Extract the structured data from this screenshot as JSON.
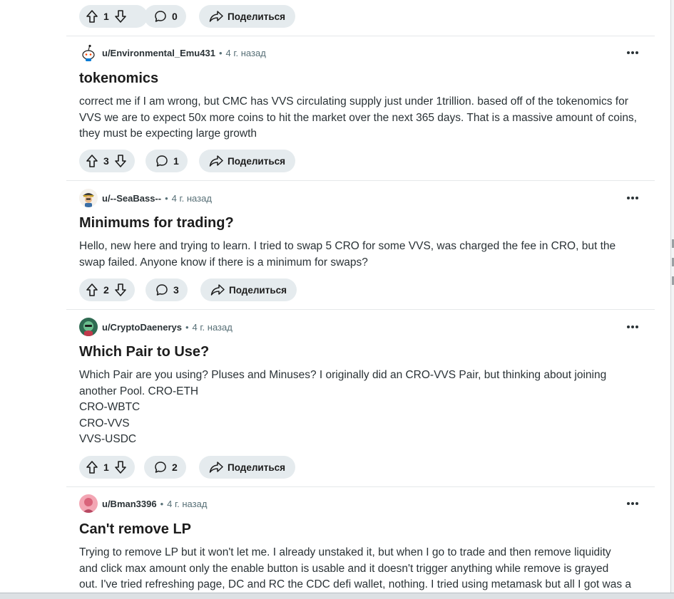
{
  "top_actions": {
    "votes": "1",
    "comments": "0",
    "share_label": "Поделиться"
  },
  "posts": [
    {
      "username": "u/Environmental_Emu431",
      "time": "4 г. назад",
      "title": "tokenomics",
      "body": [
        "correct me if I am wrong, but CMC has VVS circulating supply just under 1trillion. based off of the tokenomics for",
        "VVS we are to expect 50x more coins to hit the market over the next 365 days. That is a massive amount of coins,",
        "they must be expecting large growth"
      ],
      "votes": "3",
      "comments": "1",
      "share_label": "Поделиться",
      "avatar_icon": "snoo-avatar-icon"
    },
    {
      "username": "u/--SeaBass--",
      "time": "4 г. назад",
      "title": "Minimums for trading?",
      "body": [
        "Hello, new here and trying to learn. I tried to swap 5 CRO for some VVS, was charged the fee in CRO, but the",
        "swap failed. Anyone know if there is a minimum for swaps?"
      ],
      "votes": "2",
      "comments": "3",
      "share_label": "Поделиться",
      "avatar_icon": "pirate-avatar-icon"
    },
    {
      "username": "u/CryptoDaenerys",
      "time": "4 г. назад",
      "title": "Which Pair to Use?",
      "body": [
        "Which Pair are you using? Pluses and Minuses? I originally did an CRO-VVS Pair, but thinking about joining",
        "another Pool. CRO-ETH",
        "CRO-WBTC",
        "CRO-VVS",
        "VVS-USDC"
      ],
      "votes": "1",
      "comments": "2",
      "share_label": "Поделиться",
      "avatar_icon": "dragon-avatar-icon"
    },
    {
      "username": "u/Bman3396",
      "time": "4 г. назад",
      "title": "Can't remove LP",
      "body": [
        "Trying to remove LP but it won't let me. I already unstaked it, but when I go to trade and then remove liquidity",
        "and click max amount only the enable button is usable and it doesn't trigger anything while remove is grayed",
        "out. I've tried refreshing page, DC and RC the CDC defi wallet, nothing. I tried using metamask but all I got was a"
      ],
      "votes": "",
      "comments": "",
      "share_label": "",
      "avatar_icon": "pink-avatar-icon"
    }
  ],
  "separator": "•",
  "colors": {
    "pill_bg": "#e5ebee",
    "meta_text": "#576f76",
    "divider": "#e5e8ea"
  }
}
